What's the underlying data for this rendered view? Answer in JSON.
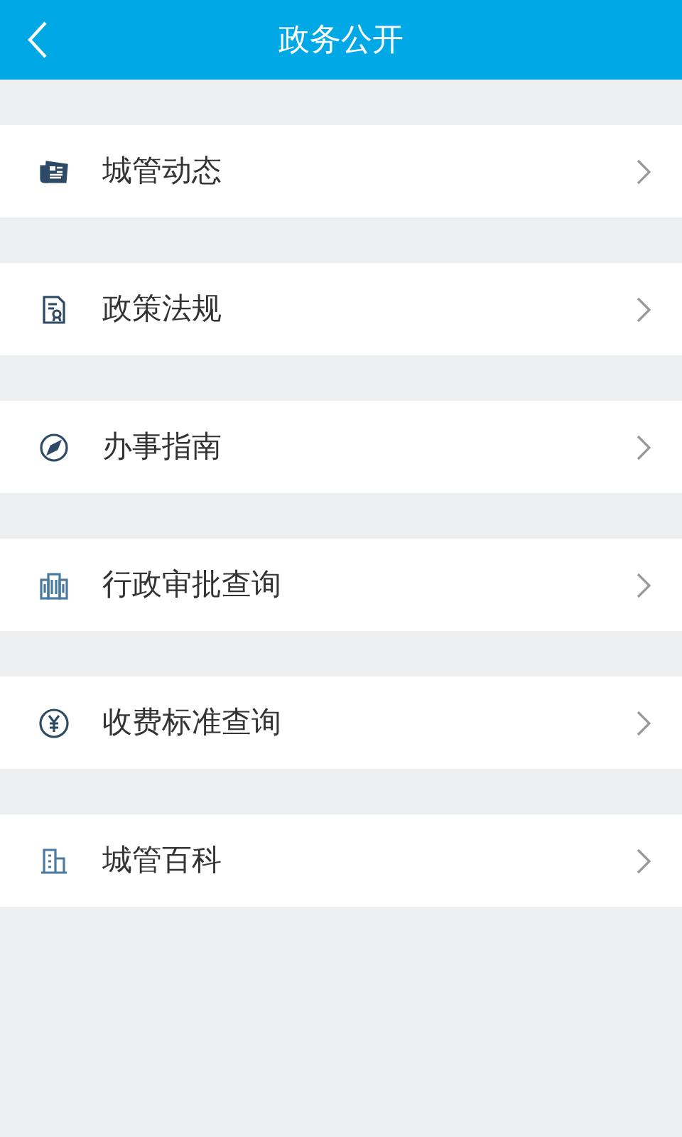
{
  "header": {
    "title": "政务公开"
  },
  "items": [
    {
      "kind": "news",
      "label": "城管动态"
    },
    {
      "kind": "document",
      "label": "政策法规"
    },
    {
      "kind": "compass",
      "label": "办事指南"
    },
    {
      "kind": "buildings",
      "label": "行政审批查询"
    },
    {
      "kind": "yen",
      "label": "收费标准查询"
    },
    {
      "kind": "building",
      "label": "城管百科"
    }
  ]
}
